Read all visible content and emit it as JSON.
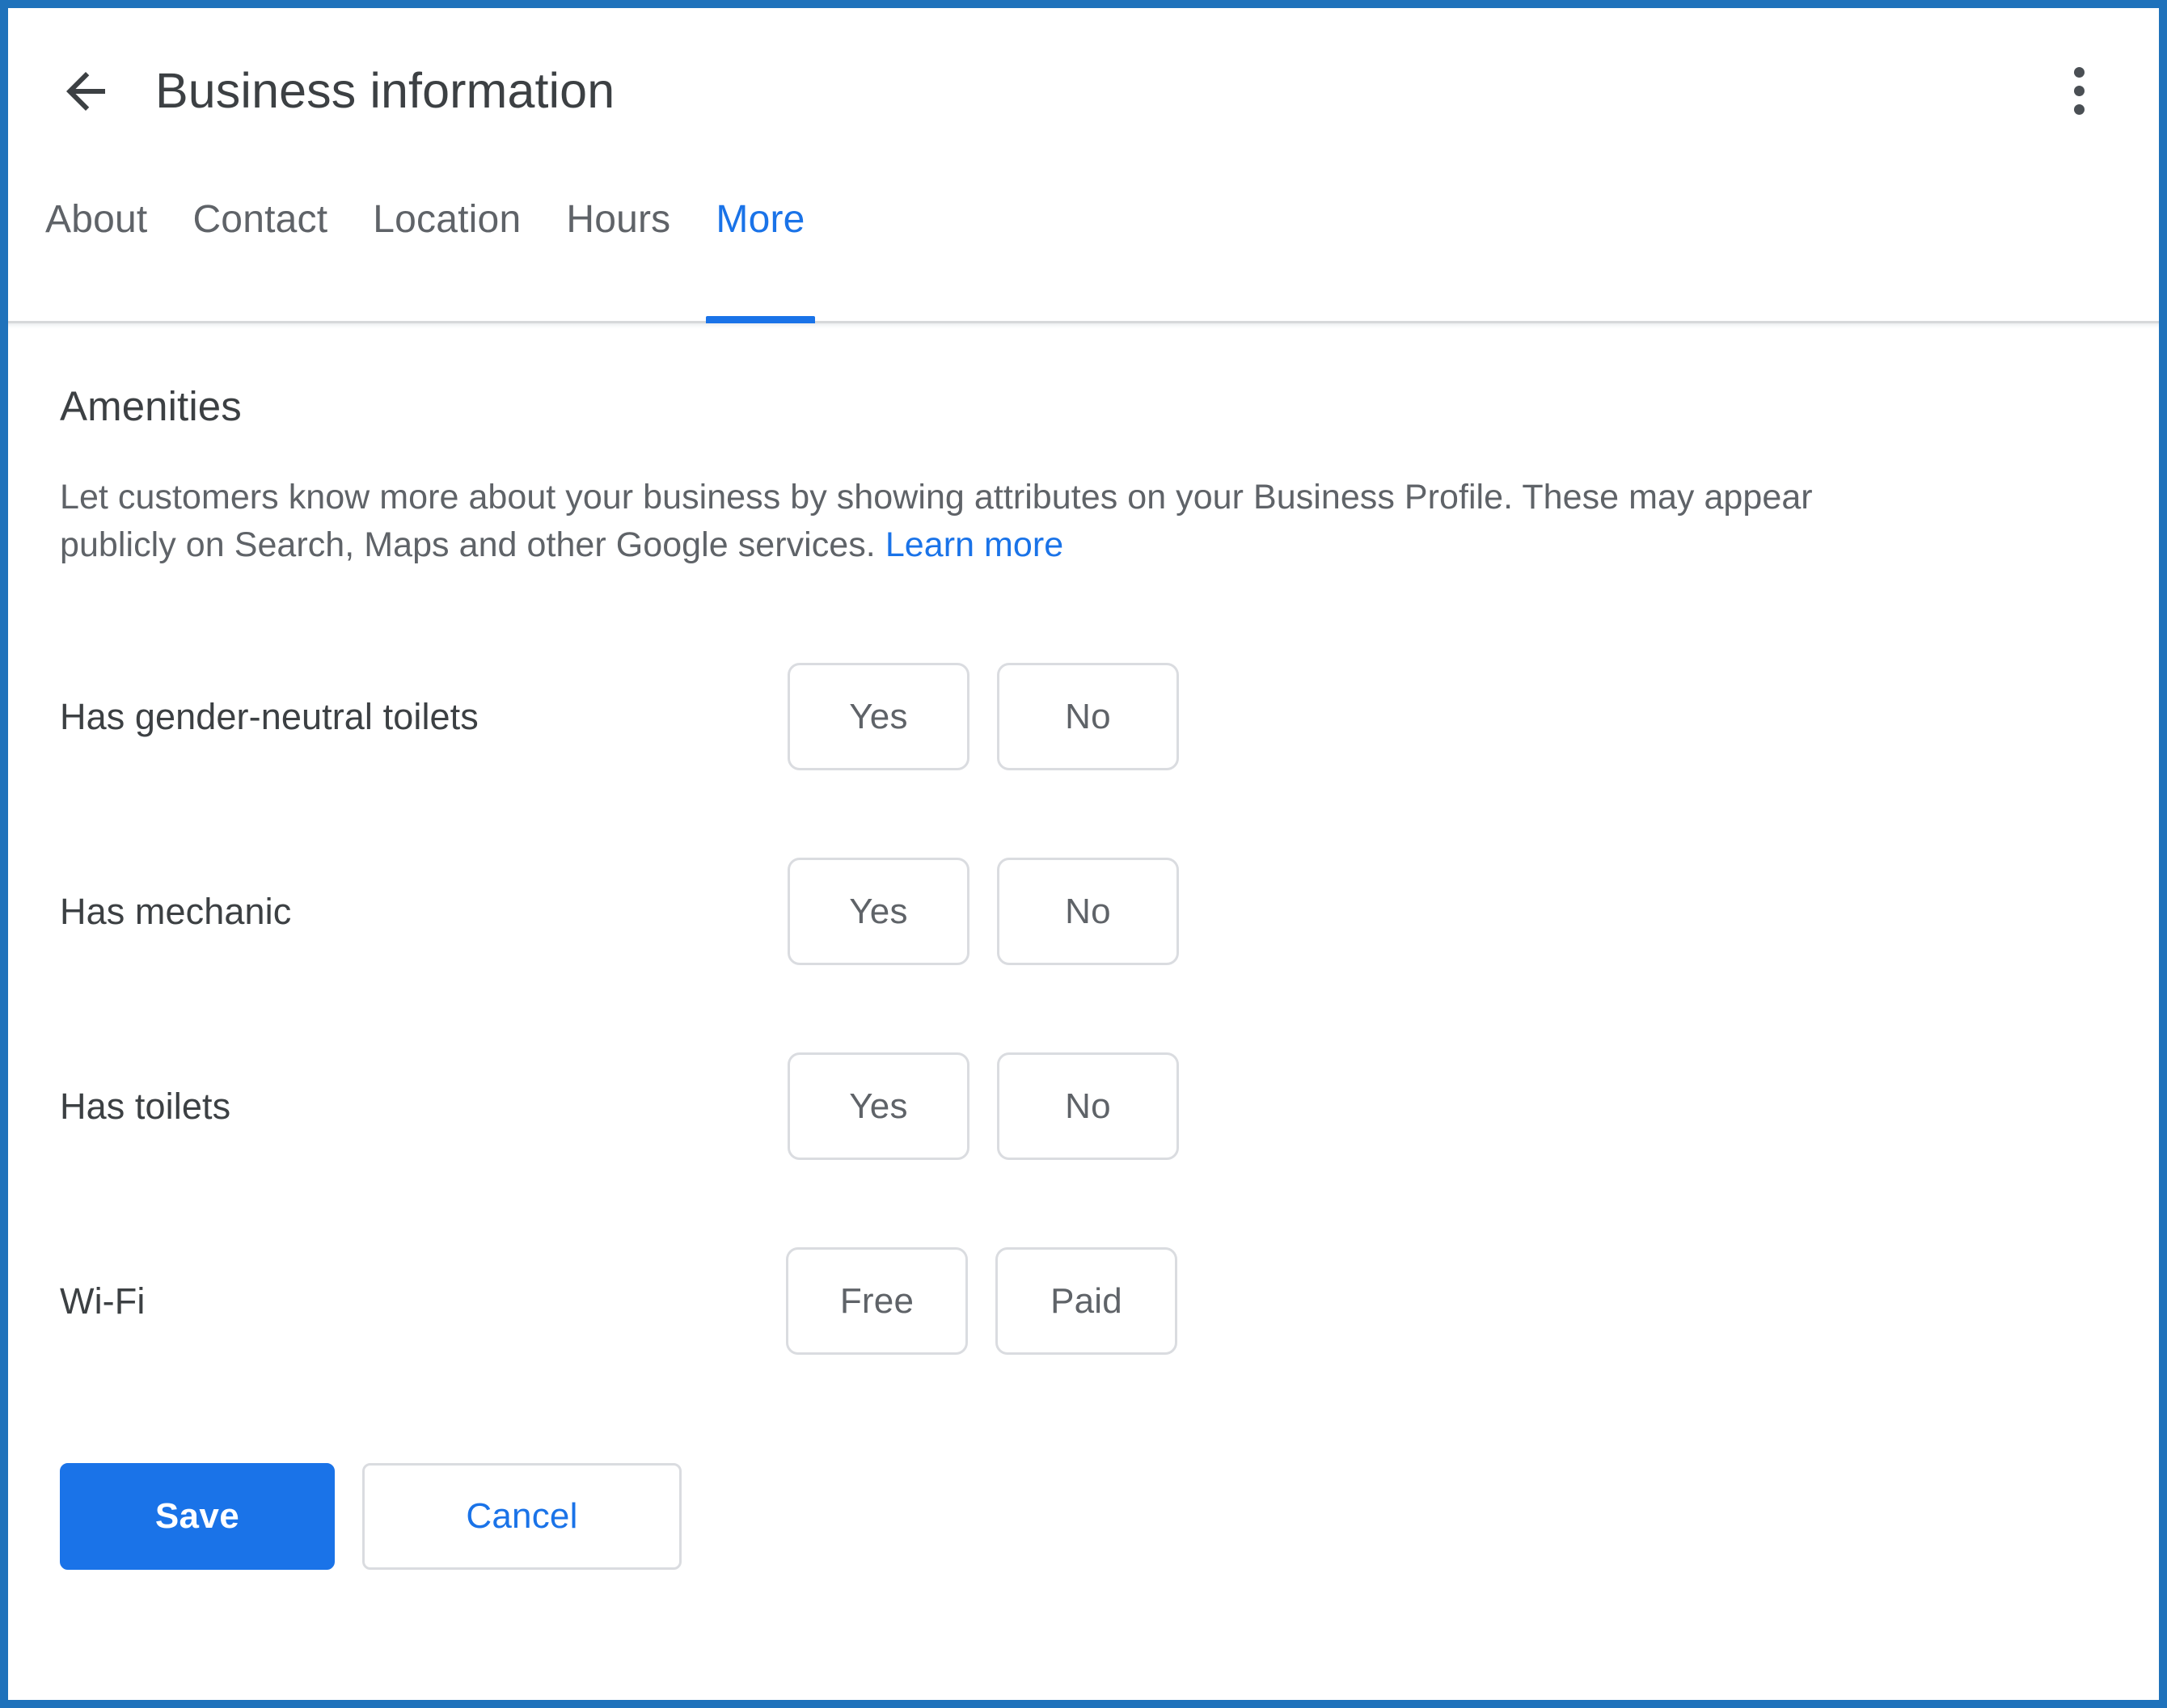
{
  "colors": {
    "frame_border": "#1f72bb",
    "accent_blue": "#1a73e8",
    "text_primary": "#3c4043",
    "text_secondary": "#5f6368",
    "button_border": "#dadce0"
  },
  "header": {
    "title": "Business information",
    "back_icon": "arrow-back-icon",
    "overflow_icon": "more-vert-icon"
  },
  "tabs": {
    "items": [
      {
        "label": "About",
        "active": false
      },
      {
        "label": "Contact",
        "active": false
      },
      {
        "label": "Location",
        "active": false
      },
      {
        "label": "Hours",
        "active": false
      },
      {
        "label": "More",
        "active": true
      }
    ]
  },
  "content": {
    "section_heading": "Amenities",
    "description_text": "Let customers know more about your business by showing attributes on your Business Profile. These may appear publicly on Search, Maps and other Google services. ",
    "learn_more_label": "Learn more",
    "attributes": [
      {
        "label": "Has gender-neutral toilets",
        "options": [
          {
            "label": "Yes",
            "selected": false
          },
          {
            "label": "No",
            "selected": false
          }
        ]
      },
      {
        "label": "Has mechanic",
        "options": [
          {
            "label": "Yes",
            "selected": false
          },
          {
            "label": "No",
            "selected": false
          }
        ]
      },
      {
        "label": "Has toilets",
        "options": [
          {
            "label": "Yes",
            "selected": false
          },
          {
            "label": "No",
            "selected": false
          }
        ]
      },
      {
        "label": "Wi-Fi",
        "options": [
          {
            "label": "Free",
            "selected": false
          },
          {
            "label": "Paid",
            "selected": false
          }
        ]
      }
    ]
  },
  "actions": {
    "save_label": "Save",
    "cancel_label": "Cancel"
  }
}
